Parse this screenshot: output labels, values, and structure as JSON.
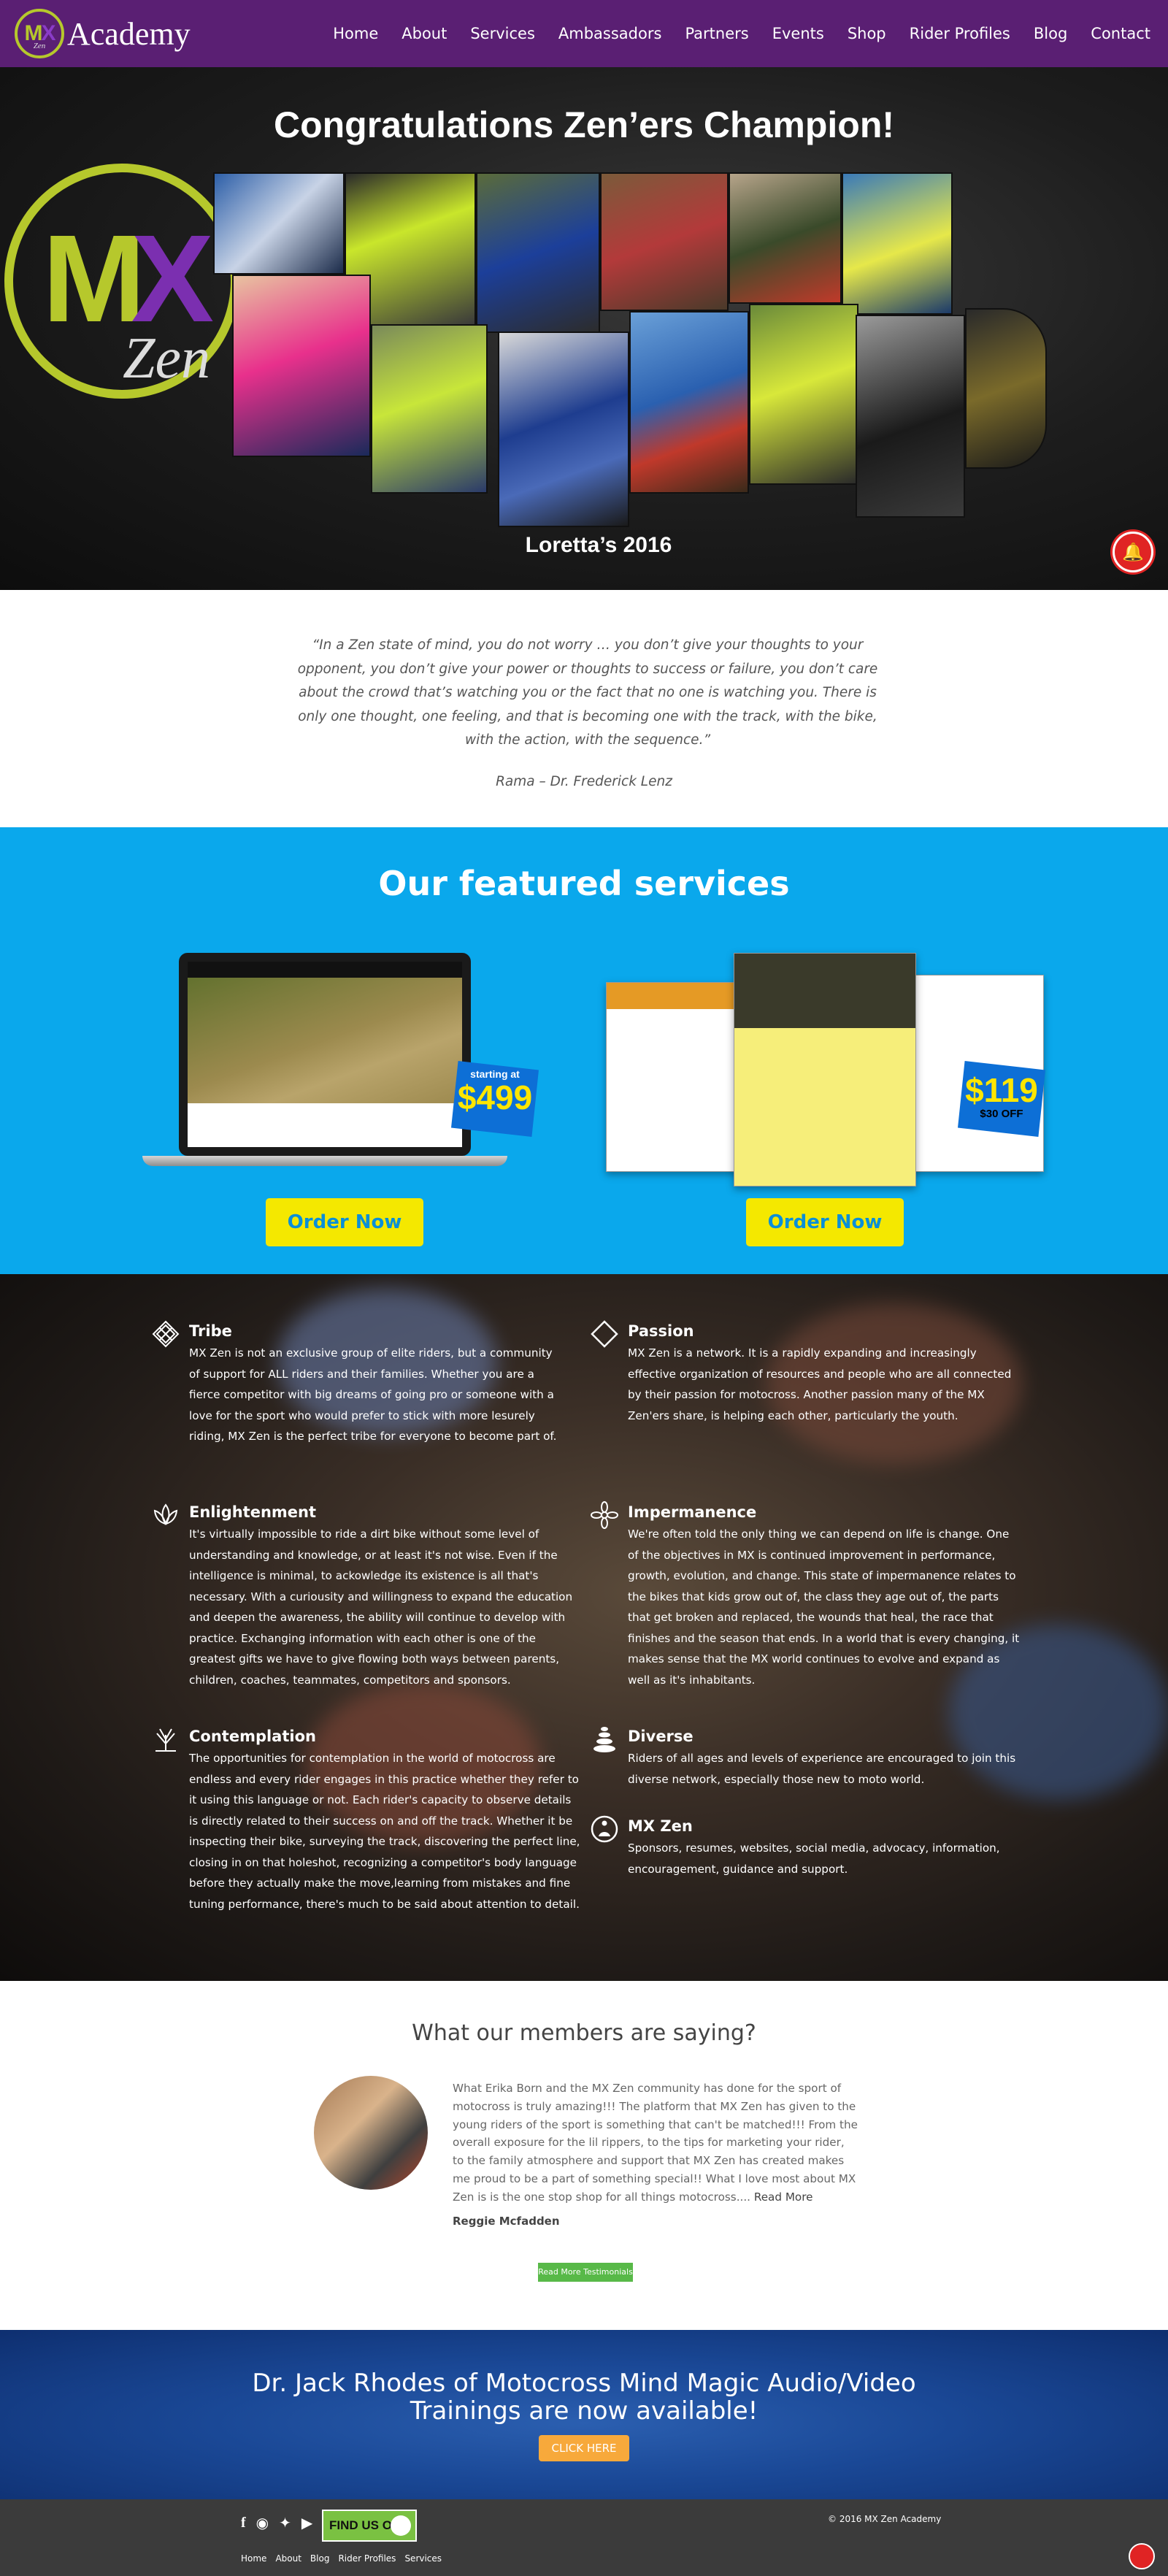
{
  "colors": {
    "nav": "#5a1f73",
    "brand_green": "#b6c82c",
    "services_bg": "#0aa8ec",
    "order_button": "#f4e800",
    "audio_bg": "#1a4896",
    "footer_bg": "#3b3b3b"
  },
  "nav": {
    "logo_text": "Academy",
    "logo_mark": "MX",
    "logo_sub": "Zen",
    "items": [
      "Home",
      "About",
      "Services",
      "Ambassadors",
      "Partners",
      "Events",
      "Shop",
      "Rider Profiles",
      "Blog",
      "Contact"
    ]
  },
  "hero": {
    "title": "Congratulations Zen’ers Champion!",
    "logo_zen": "Zen",
    "caption": "Loretta’s 2016",
    "bell_icon": "notification-bell-icon"
  },
  "quote": {
    "text": "“In a Zen state of mind, you do not worry … you don’t give your thoughts to your opponent, you don’t give your power or thoughts to success or failure, you don’t care about the crowd that’s watching you or the fact that no one is watching you. There is only one thought, one feeling, and that is becoming one with the track, with the bike, with the action, with the sequence.”",
    "author": "Rama – Dr. Frederick Lenz"
  },
  "services": {
    "title": "Our featured services",
    "website": {
      "badge_small": "starting at",
      "badge_price": "$499",
      "button": "Order Now"
    },
    "resume": {
      "badge_price": "$119",
      "badge_off": "$30 OFF",
      "button": "Order Now"
    }
  },
  "features": [
    {
      "title": "Tribe",
      "icon": "knot-icon",
      "text": "MX Zen is not an exclusive group of elite riders, but a community of support for ALL riders and their families. Whether you are a fierce competitor with big dreams of going pro or someone with a love for the sport who would prefer to stick with more lesurely riding, MX Zen is the perfect tribe for everyone to become part of."
    },
    {
      "title": "Passion",
      "icon": "diamond-icon",
      "text": "MX Zen is a network. It is a rapidly expanding and increasingly effective organization of resources and people who are all connected by their passion for motocross. Another passion many of the MX Zen'ers share, is helping each other, particularly the youth."
    },
    {
      "title": "Enlightenment",
      "icon": "lotus-icon",
      "text": "It's virtually impossible to ride a dirt bike without some level of understanding and knowledge, or at least it's not wise. Even if the intelligence is minimal, to ackowledge its existence is all that's necessary. With a curiousity and willingness to expand the education and deepen the awareness, the ability will continue to develop with practice. Exchanging information with each other is one of the greatest gifts we have to give flowing both ways between parents, children, coaches, teammates, competitors and sponsors."
    },
    {
      "title": "Impermanence",
      "icon": "flower-icon",
      "text": "We're often told the only thing we can depend on life is change. One of the objectives in MX is continued improvement in performance, growth, evolution, and change. This state of impermanence relates to the bikes that kids grow out of, the class they age out of, the parts that get broken and replaced, the wounds that heal, the race that finishes and the season that ends. In a world that is every changing, it makes sense that the MX world continues to evolve and expand as well as it's inhabitants."
    },
    {
      "title": "Contemplation",
      "icon": "sprout-icon",
      "text": "The opportunities for contemplation in the world of motocross are endless and every rider engages in this practice whether they refer to it using this language or not. Each rider's capacity to observe details is directly related to their success on and off the track. Whether it be inspecting their bike, surveying the track, discovering the perfect line, closing in on that holeshot, recognizing a competitor's body language before they actually make the move,learning from mistakes and fine tuning performance, there's much to be said about attention to detail."
    },
    {
      "title": "Diverse",
      "icon": "stones-icon",
      "text": "Riders of all ages and levels of experience are encouraged to join this diverse network, especially those new to moto world."
    },
    {
      "title": "MX Zen",
      "icon": "meditation-icon",
      "text": "Sponsors, resumes, websites, social media, advocacy, information, encouragement, guidance and support."
    }
  ],
  "testimonials": {
    "title": "What our members are saying?",
    "text": "What Erika Born and the MX Zen community has done for the sport of motocross is truly amazing!!! The platform that MX Zen has given to the young riders of the sport is something that can't be matched!!! From the overall exposure for the lil rippers, to the tips for marketing your rider, to the family atmosphere and support that MX Zen has created makes me proud to be a part of something special!! What I love most about MX Zen is is the one stop shop for all things motocross....",
    "read_more": "Read More",
    "name": "Reggie Mcfadden",
    "button": "Read More Testimonials"
  },
  "audio": {
    "title_line1": "Dr. Jack Rhodes of Motocross Mind Magic Audio/Video",
    "title_line2": "Trainings are now available!",
    "button": "CLICK HERE"
  },
  "footer": {
    "social_icons": [
      "facebook-icon",
      "instagram-icon",
      "twitter-icon",
      "youtube-icon"
    ],
    "find_us": "FIND US ON",
    "links": [
      "Home",
      "About",
      "Blog",
      "Rider Profiles",
      "Services"
    ],
    "copyright": "© 2016 MX Zen Academy"
  }
}
